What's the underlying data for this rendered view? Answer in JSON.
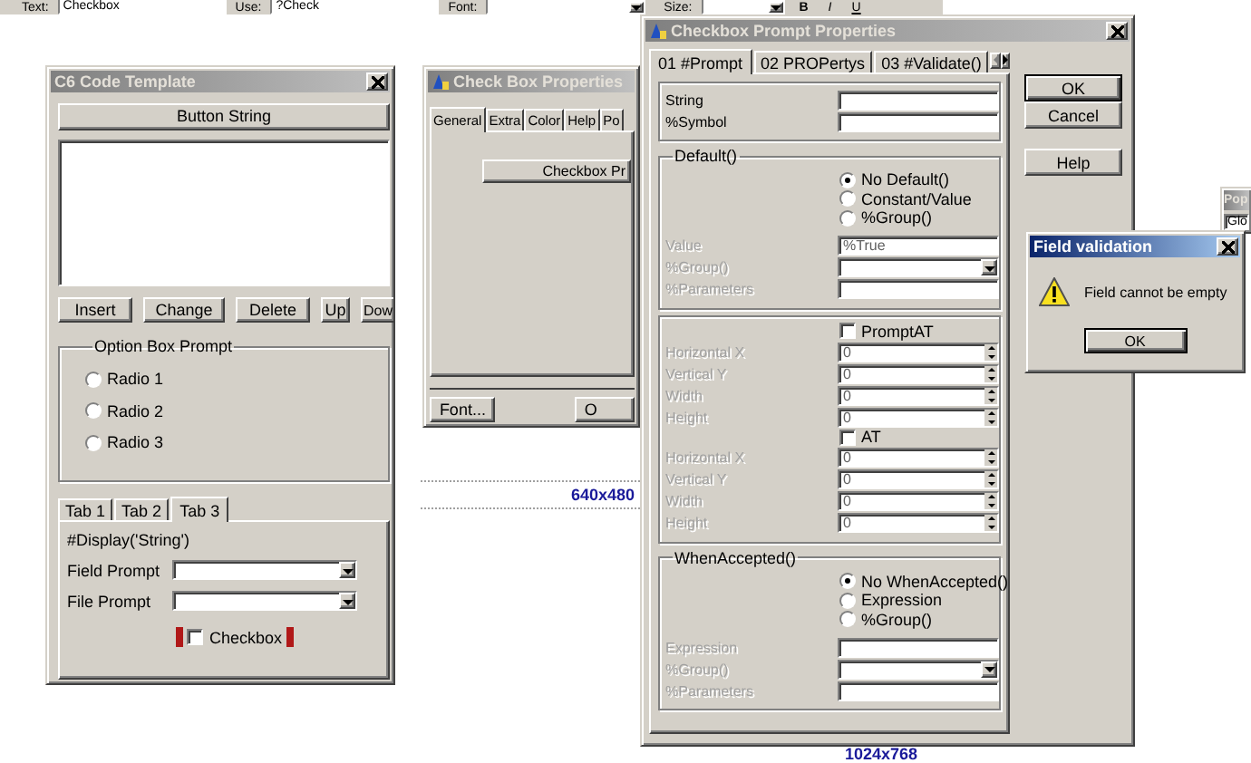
{
  "toolbar": {
    "fields": [
      {
        "label": "Text:",
        "kind": "text",
        "value": "Checkbox"
      },
      {
        "label": "Use:",
        "kind": "text",
        "value": "?Check"
      },
      {
        "label": "Font:",
        "kind": "combo"
      },
      {
        "label": "Size:",
        "kind": "combo"
      }
    ],
    "style_buttons": [
      "B",
      "I",
      "U"
    ]
  },
  "guides": [
    "640x480",
    "1024x768"
  ],
  "code_template": {
    "title": "C6 Code Template",
    "active": false,
    "button_string": "Button String",
    "buttons": [
      "Insert",
      "Change",
      "Delete",
      "Up",
      "Dow"
    ],
    "option_group": {
      "title": "Option Box Prompt",
      "radios": [
        {
          "label": "Radio 1",
          "selected": false
        },
        {
          "label": "Radio 2",
          "selected": false
        },
        {
          "label": "Radio 3",
          "selected": false
        }
      ]
    },
    "tabs": [
      {
        "label": "Tab 1",
        "selected": false
      },
      {
        "label": "Tab 2",
        "selected": false
      },
      {
        "label": "Tab 3",
        "selected": true
      }
    ],
    "display": "#Display('String')",
    "fields": [
      {
        "label": "Field Prompt",
        "kind": "combo"
      },
      {
        "label": "File Prompt",
        "kind": "combo"
      }
    ],
    "checkbox": {
      "label": "Checkbox",
      "checked": false,
      "selected": true
    }
  },
  "checkbox_properties": {
    "title": "Check Box Properties",
    "active": false,
    "tabs": [
      {
        "label": "General",
        "selected": true
      },
      {
        "label": "Extra",
        "selected": false
      },
      {
        "label": "Color",
        "selected": false
      },
      {
        "label": "Help",
        "selected": false
      },
      {
        "label": "Po",
        "selected": false
      }
    ],
    "prompt_button": "Checkbox Pr",
    "buttons": [
      "Font...",
      "O"
    ]
  },
  "prompt_properties": {
    "title": "Checkbox Prompt Properties",
    "active": false,
    "tabs": [
      {
        "label": "01 #Prompt",
        "selected": true
      },
      {
        "label": "02 PROPertys",
        "selected": false
      },
      {
        "label": "03 #Validate()",
        "selected": false
      }
    ],
    "buttons": [
      "OK",
      "Cancel",
      "Help"
    ],
    "groups": [
      {
        "items": [
          {
            "kind": "text",
            "label": "String",
            "disabled": false
          },
          {
            "kind": "text",
            "label": "%Symbol",
            "disabled": false
          }
        ]
      },
      {
        "title": "Default()",
        "items": [
          {
            "kind": "radio",
            "label": "No Default()",
            "selected": true
          },
          {
            "kind": "radio",
            "label": "Constant/Value",
            "selected": false
          },
          {
            "kind": "radio",
            "label": "%Group()",
            "selected": false
          },
          {
            "kind": "text",
            "label": "Value",
            "value": "%True",
            "disabled": true
          },
          {
            "kind": "combo",
            "label": "%Group()",
            "disabled": true
          },
          {
            "kind": "text",
            "label": "%Parameters",
            "disabled": true
          }
        ]
      },
      {
        "items": [
          {
            "kind": "checkbox",
            "label": "PromptAT",
            "checked": false
          },
          {
            "kind": "spin",
            "label": "Horizontal X",
            "value": "0",
            "disabled": true
          },
          {
            "kind": "spin",
            "label": "Vertical Y",
            "value": "0",
            "disabled": true
          },
          {
            "kind": "spin",
            "label": "Width",
            "value": "0",
            "disabled": true
          },
          {
            "kind": "spin",
            "label": "Height",
            "value": "0",
            "disabled": true
          },
          {
            "kind": "checkbox",
            "label": "AT",
            "checked": false
          },
          {
            "kind": "spin",
            "label": "Horizontal X",
            "value": "0",
            "disabled": true
          },
          {
            "kind": "spin",
            "label": "Vertical Y",
            "value": "0",
            "disabled": true
          },
          {
            "kind": "spin",
            "label": "Width",
            "value": "0",
            "disabled": true
          },
          {
            "kind": "spin",
            "label": "Height",
            "value": "0",
            "disabled": true
          }
        ]
      },
      {
        "title": "WhenAccepted()",
        "items": [
          {
            "kind": "radio",
            "label": "No WhenAccepted()",
            "selected": true
          },
          {
            "kind": "radio",
            "label": "Expression",
            "selected": false
          },
          {
            "kind": "radio",
            "label": "%Group()",
            "selected": false
          },
          {
            "kind": "text",
            "label": "Expression",
            "disabled": true
          },
          {
            "kind": "combo",
            "label": "%Group()",
            "disabled": true
          },
          {
            "kind": "text",
            "label": "%Parameters",
            "disabled": true
          }
        ]
      }
    ]
  },
  "validation": {
    "title": "Field validation",
    "active": true,
    "message": "Field cannot be empty",
    "button": "OK"
  },
  "pop_window": {
    "title": "Pop",
    "active": false,
    "field": "Glo"
  }
}
